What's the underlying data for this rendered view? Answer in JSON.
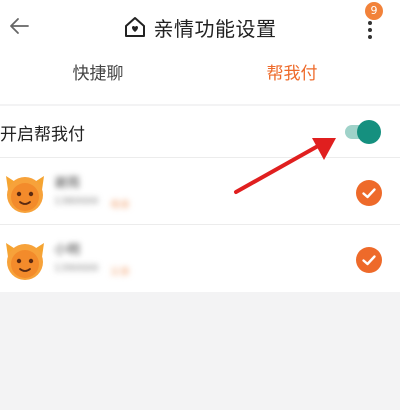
{
  "header": {
    "title": "亲情功能设置",
    "back_icon": "back-arrow-icon",
    "home_icon": "home-heart-icon",
    "more_icon": "more-vertical-icon",
    "badge_count": "9"
  },
  "tabs": [
    {
      "label": "快捷聊",
      "active": false
    },
    {
      "label": "帮我付",
      "active": true
    }
  ],
  "toggle_row": {
    "label": "开启帮我付",
    "enabled": true
  },
  "members": [
    {
      "name": "谢雨",
      "detail": "1380000",
      "tag": "母亲",
      "checked": true
    },
    {
      "name": "小明",
      "detail": "1390000",
      "tag": "父亲",
      "checked": true
    }
  ],
  "colors": {
    "accent": "#ee6a2a",
    "toggle_on": "#15907f",
    "toggle_track": "#9fd2c9",
    "annotation_arrow": "#e01f1f"
  }
}
